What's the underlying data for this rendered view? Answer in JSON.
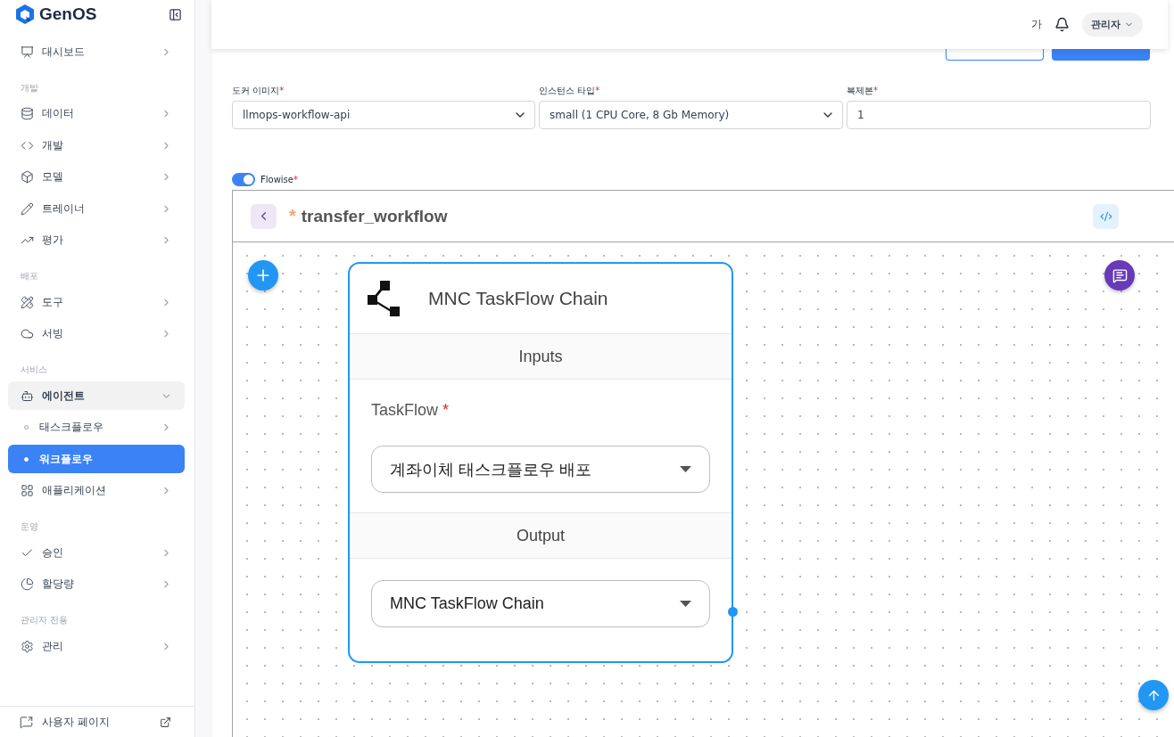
{
  "brand": {
    "name": "GenOS"
  },
  "sidebar": {
    "sections": [
      {
        "items": [
          {
            "label": "대시보드",
            "expanded": false,
            "selected": false
          }
        ]
      },
      {
        "heading": "개발",
        "items": [
          {
            "label": "데이터",
            "expanded": false,
            "selected": false
          },
          {
            "label": "개발",
            "expanded": false,
            "selected": false
          },
          {
            "label": "모델",
            "expanded": false,
            "selected": false
          },
          {
            "label": "트레이너",
            "expanded": false,
            "selected": false
          },
          {
            "label": "평가",
            "expanded": false,
            "selected": false
          }
        ]
      },
      {
        "heading": "배포",
        "items": [
          {
            "label": "도구",
            "expanded": false,
            "selected": false
          },
          {
            "label": "서빙",
            "expanded": false,
            "selected": false
          }
        ]
      },
      {
        "heading": "서비스",
        "items": [
          {
            "label": "에이전트",
            "expanded": true,
            "selected": false,
            "children": [
              {
                "label": "태스크플로우",
                "selected": false
              },
              {
                "label": "워크플로우",
                "selected": true
              }
            ]
          },
          {
            "label": "애플리케이션",
            "expanded": false,
            "selected": false
          }
        ]
      },
      {
        "heading": "운영",
        "items": [
          {
            "label": "승인",
            "expanded": false,
            "selected": false
          },
          {
            "label": "할당량",
            "expanded": false,
            "selected": false
          }
        ]
      },
      {
        "heading": "관리자 전용",
        "items": [
          {
            "label": "관리",
            "expanded": false,
            "selected": false
          }
        ]
      }
    ],
    "footer": {
      "label": "사용자 페이지"
    }
  },
  "header": {
    "font_button": "가",
    "user": "관리자"
  },
  "form": {
    "fields": [
      {
        "kind": "select",
        "label": "도커 이미지",
        "mark": "*",
        "value": "llmops-workflow-api"
      },
      {
        "kind": "select",
        "label": "인스턴스 타입",
        "mark": "*",
        "value": "small (1 CPU Core, 8 Gb Memory)"
      },
      {
        "kind": "input",
        "label": "복제본",
        "mark": "*",
        "value": "1"
      }
    ]
  },
  "flowise": {
    "label": "Flowise",
    "mark": "*",
    "on": true
  },
  "flow": {
    "unsaved_mark": "*",
    "title": "transfer_workflow",
    "node": {
      "title": "MNC TaskFlow Chain",
      "sections": [
        {
          "heading": "Inputs",
          "label": "TaskFlow",
          "mark": "*",
          "value": "계좌이체 태스크플로우 배포"
        },
        {
          "heading": "Output",
          "value": "MNC TaskFlow Chain"
        }
      ]
    }
  }
}
